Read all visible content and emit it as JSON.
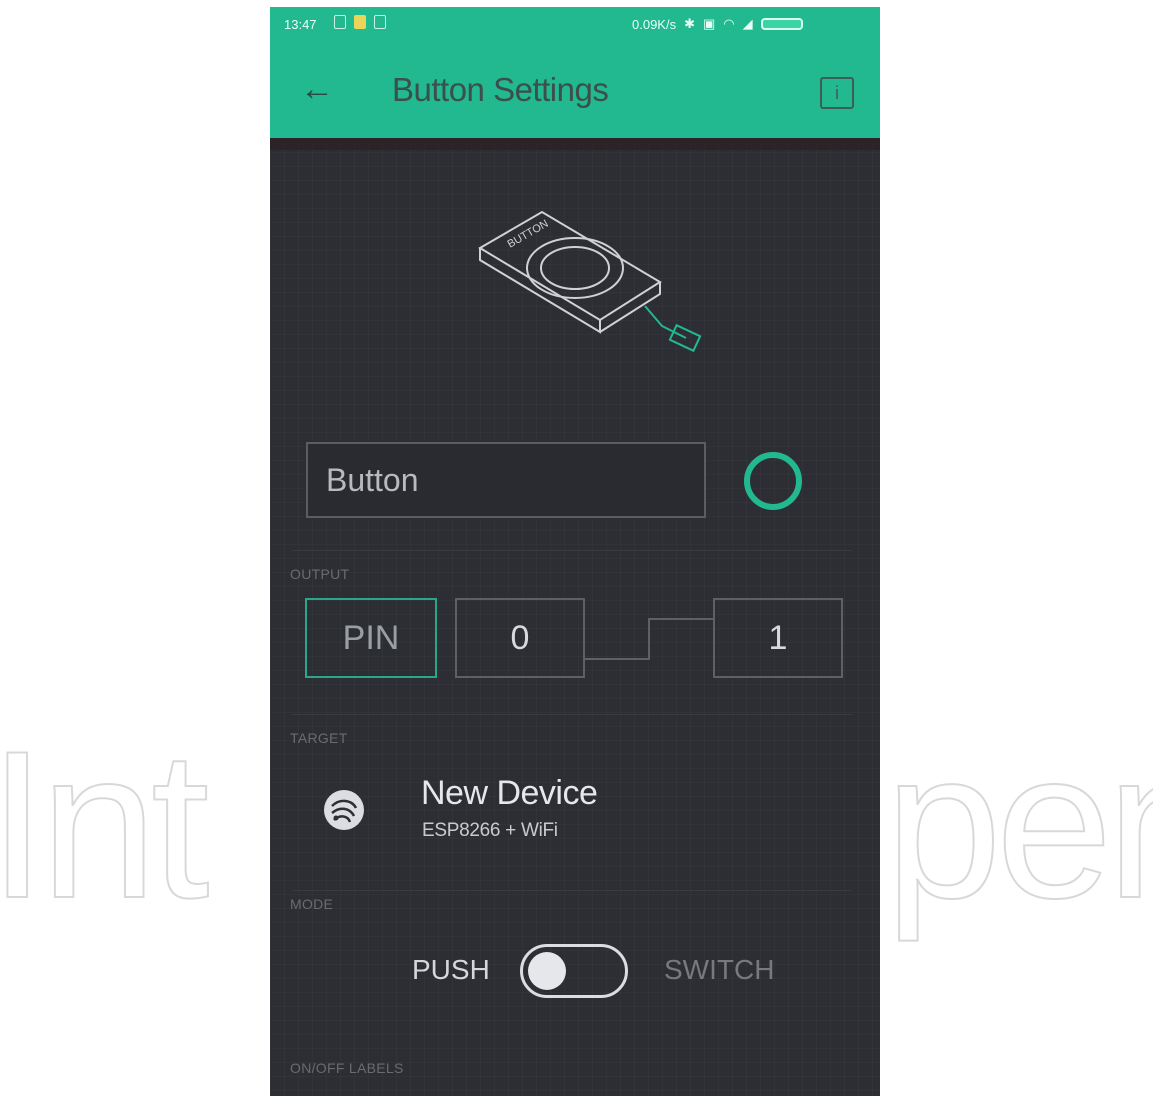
{
  "status_bar": {
    "time": "13:47",
    "speed": "0.09K/s"
  },
  "app_bar": {
    "title": "Button Settings",
    "back_icon": "arrow-left-icon",
    "info_icon": "info-icon"
  },
  "widget": {
    "illustration_text": "BUTTON",
    "name_value": "Button",
    "color": "#22b990"
  },
  "output": {
    "label": "OUTPUT",
    "pin_label": "PIN",
    "low_value": "0",
    "high_value": "1"
  },
  "target": {
    "label": "TARGET",
    "device_name": "New Device",
    "device_type": "ESP8266 + WiFi"
  },
  "mode": {
    "label": "MODE",
    "push_label": "PUSH",
    "switch_label": "SWITCH",
    "selected": "PUSH"
  },
  "labels_section": {
    "label": "ON/OFF LABELS"
  },
  "colors": {
    "accent": "#22b990",
    "background": "#2d2e33"
  }
}
